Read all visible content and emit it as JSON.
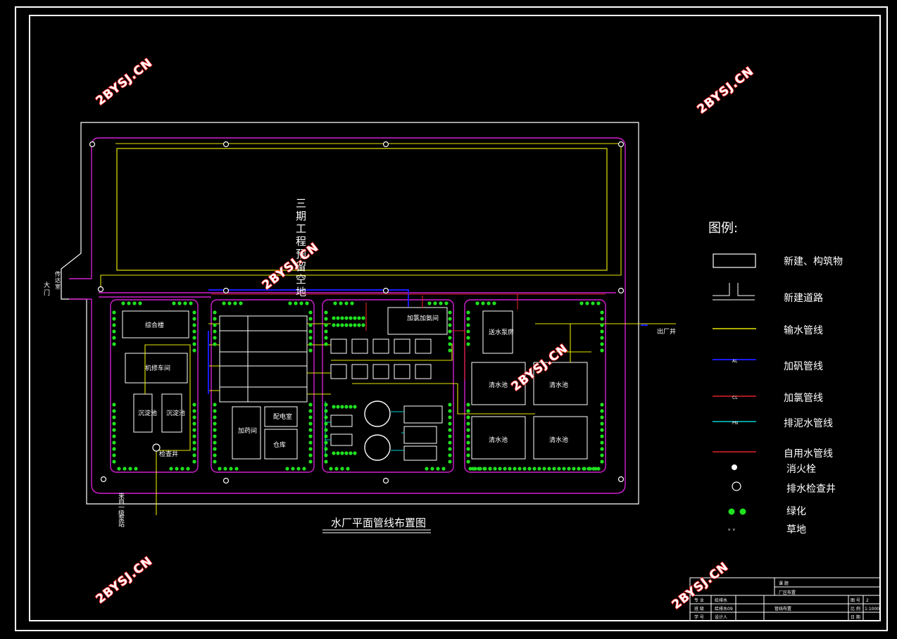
{
  "drawing": {
    "title": "水厂平面管线布置图",
    "reserved_area_label": "三期工程预留空地",
    "gate_label": "大门",
    "guard_label": "传达室",
    "outlet_label": "出厂井",
    "inlet_label": "来自一级泵站",
    "drain_well_label": "检查井",
    "buildings": {
      "office": "综合楼",
      "repair": "机修车间",
      "sludge1": "沉淀池",
      "sludge2": "沉淀池",
      "dosing": "加药间",
      "chlorine": "加氯加氨间",
      "pump": "送水泵房",
      "substation": "配电室",
      "warehouse": "仓库",
      "clear1": "清水池",
      "clear2": "清水池",
      "clear3": "清水池",
      "clear4": "清水池"
    }
  },
  "legend": {
    "title": "图例:",
    "items": [
      {
        "label": "新建、构筑物",
        "symbol": "building"
      },
      {
        "label": "新建道路",
        "symbol": "road"
      },
      {
        "label": "输水管线",
        "symbol": "line",
        "color": "#e6e600"
      },
      {
        "label": "加矾管线",
        "symbol": "line",
        "color": "#1a1aff",
        "code": "AL"
      },
      {
        "label": "加氯管线",
        "symbol": "line",
        "color": "#e0202a",
        "code": "CL"
      },
      {
        "label": "排泥水管线",
        "symbol": "line",
        "color": "#00d0d0",
        "code": "PN"
      },
      {
        "label": "自用水管线",
        "symbol": "line",
        "color": "#e0202a"
      },
      {
        "label": "消火栓",
        "symbol": "hydrant"
      },
      {
        "label": "排水检查井",
        "symbol": "manhole"
      },
      {
        "label": "绿化",
        "symbol": "green"
      },
      {
        "label": "草地",
        "symbol": "grass"
      }
    ]
  },
  "title_block": {
    "header": "课 题",
    "subtitle": "厂区布置",
    "rows": [
      {
        "a": "专 业",
        "b": "给排水"
      },
      {
        "a": "班 级",
        "b": "给排水09"
      },
      {
        "a": "学 号",
        "b": "设计人"
      }
    ],
    "name": "管线布置",
    "sheet_label": "图 号",
    "sheet_value": "2",
    "scale_label": "比 例",
    "scale_value": "1:1000",
    "date_label": "日 期"
  },
  "watermark": "2BYSJ.CN",
  "colors": {
    "frame": "#ffffff",
    "road": "#d020d0",
    "water": "#e6e600",
    "alum": "#1a1aff",
    "chlorine": "#e0202a",
    "sludge": "#00d0d0",
    "green": "#20e020",
    "boundary": "#ffffff"
  }
}
